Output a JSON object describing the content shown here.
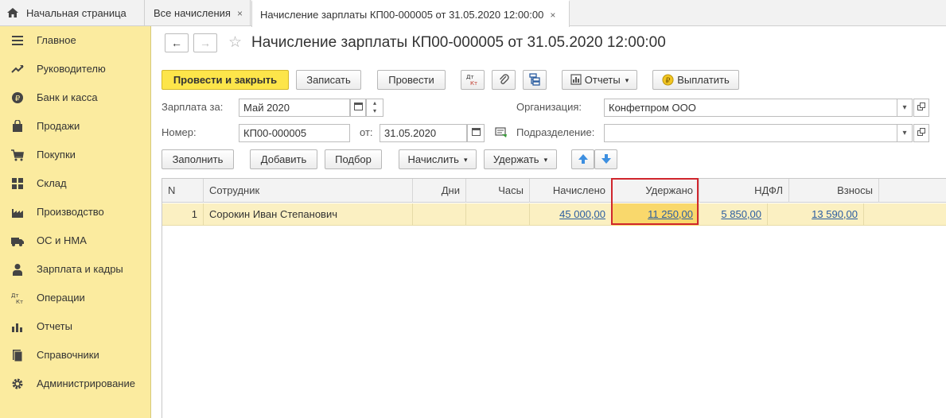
{
  "tabs": {
    "home": "Начальная страница",
    "all": "Все начисления",
    "active": "Начисление зарплаты КП00-000005 от 31.05.2020 12:00:00",
    "close": "×"
  },
  "sidebar": {
    "items": [
      {
        "label": "Главное",
        "icon": "menu-icon"
      },
      {
        "label": "Руководителю",
        "icon": "trend-icon"
      },
      {
        "label": "Банк и касса",
        "icon": "ruble-coin-icon"
      },
      {
        "label": "Продажи",
        "icon": "shopping-bag-icon"
      },
      {
        "label": "Покупки",
        "icon": "cart-icon"
      },
      {
        "label": "Склад",
        "icon": "grid-icon"
      },
      {
        "label": "Производство",
        "icon": "factory-icon"
      },
      {
        "label": "ОС и НМА",
        "icon": "truck-icon"
      },
      {
        "label": "Зарплата и кадры",
        "icon": "person-icon"
      },
      {
        "label": "Операции",
        "icon": "dt-kt-icon"
      },
      {
        "label": "Отчеты",
        "icon": "bar-chart-icon"
      },
      {
        "label": "Справочники",
        "icon": "book-icon"
      },
      {
        "label": "Администрирование",
        "icon": "gear-icon"
      }
    ]
  },
  "header": {
    "title": "Начисление зарплаты КП00-000005 от 31.05.2020 12:00:00",
    "back": "←",
    "forward": "→",
    "star": "☆"
  },
  "toolbar": {
    "post_close": "Провести и закрыть",
    "save": "Записать",
    "post": "Провести",
    "dtkt": "Дт Кт",
    "reports": "Отчеты",
    "pay": "Выплатить",
    "caret": "▾"
  },
  "form": {
    "salary_for_label": "Зарплата за:",
    "salary_for_value": "Май 2020",
    "number_label": "Номер:",
    "number_value": "КП00-000005",
    "date_label": "от:",
    "date_value": "31.05.2020",
    "org_label": "Организация:",
    "org_value": "Конфетпром ООО",
    "dept_label": "Подразделение:",
    "dept_value": ""
  },
  "table_toolbar": {
    "fill": "Заполнить",
    "add": "Добавить",
    "pick": "Подбор",
    "accrue": "Начислить",
    "withhold": "Удержать"
  },
  "table": {
    "columns": [
      "N",
      "Сотрудник",
      "Дни",
      "Часы",
      "Начислено",
      "Удержано",
      "НДФЛ",
      "Взносы"
    ],
    "rows": [
      {
        "n": "1",
        "employee": "Сорокин Иван Степанович",
        "days": "",
        "hours": "",
        "accrued": "45 000,00",
        "withheld": "11 250,00",
        "ndfl": "5 850,00",
        "contributions": "13 590,00"
      }
    ]
  },
  "colors": {
    "sidebar_bg": "#fbeb9f",
    "primary_btn": "#fde54a",
    "selected_row": "#fbf0c2",
    "highlight_border": "#d0262d",
    "link": "#2b5da0"
  }
}
